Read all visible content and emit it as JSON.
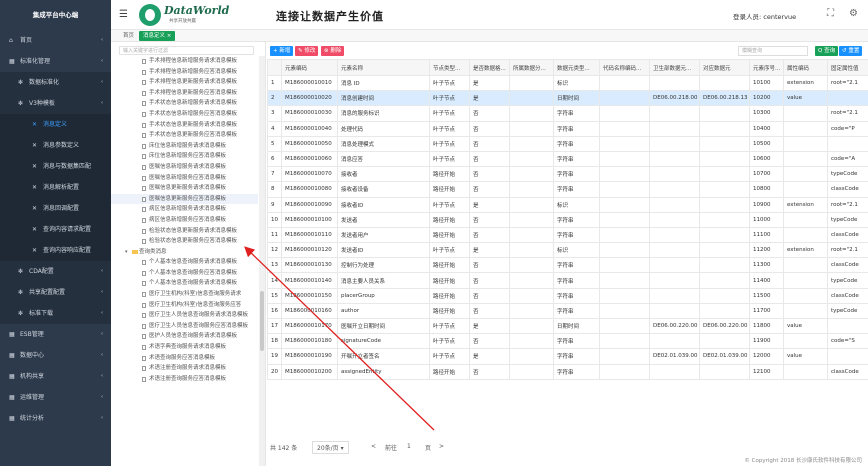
{
  "sidebar": {
    "brand": "集成平台中心端",
    "items": [
      {
        "label": "首页",
        "icon": "home-icon"
      },
      {
        "label": "标准化管理",
        "icon": "grid-icon"
      },
      {
        "label": "数据标准化",
        "icon": "gear-icon"
      },
      {
        "label": "V3种模板",
        "icon": "gear-icon"
      },
      {
        "label": "消息定义",
        "icon": "tools-icon"
      },
      {
        "label": "消息参数定义",
        "icon": "tools-icon"
      },
      {
        "label": "消息与数据集匹配",
        "icon": "tools-icon"
      },
      {
        "label": "消息解析配置",
        "icon": "tools-icon"
      },
      {
        "label": "消息回调配置",
        "icon": "tools-icon"
      },
      {
        "label": "查询内容请求配置",
        "icon": "tools-icon"
      },
      {
        "label": "查询内容响应配置",
        "icon": "tools-icon"
      },
      {
        "label": "CDA配置",
        "icon": "gear-icon"
      },
      {
        "label": "共享配置配置",
        "icon": "gear-icon"
      },
      {
        "label": "标准下载",
        "icon": "gear-icon"
      },
      {
        "label": "ESB管理",
        "icon": "grid-icon"
      },
      {
        "label": "数据中心",
        "icon": "grid-icon"
      },
      {
        "label": "机构共享",
        "icon": "grid-icon"
      },
      {
        "label": "运维管理",
        "icon": "grid-icon"
      },
      {
        "label": "统计分析",
        "icon": "grid-icon"
      }
    ]
  },
  "topbar": {
    "logo_text": "DataWorld",
    "logo_sub": "共享开放共赢",
    "slogan": "连接让数据产生价值",
    "user_label": "登录人员: centervue"
  },
  "tabs": {
    "home": "首页",
    "active": "消息定义 ×"
  },
  "tree": {
    "search_placeholder": "输入关键字进行过滤",
    "nodes": [
      "手术排程信息新增服务请求消息模板",
      "手术排程信息新增服务应答消息模板",
      "手术排程信息更新服务请求消息模板",
      "手术排程信息更新服务应答消息模板",
      "手术状态信息新增服务请求消息模板",
      "手术状态信息新增服务应答消息模板",
      "手术状态信息更新服务请求消息模板",
      "手术状态信息更新服务应答消息模板",
      "床位信息新增服务请求消息模板",
      "床位信息新增服务应答消息模板",
      "医嘱信息新增服务请求消息模板",
      "医嘱信息新增服务应答消息模板",
      "医嘱信息更新服务请求消息模板",
      "医嘱信息更新服务应答消息模板",
      "病区信息新增服务请求消息模板",
      "病区信息新增服务应答消息模板",
      "检验状态信息更新服务请求消息模板",
      "检验状态信息更新服务应答消息模板",
      "查询类消息",
      "个人基本信息查询服务请求消息模板",
      "个人基本信息查询服务应答消息模板",
      "个人基本信息查询服务请求消息模板",
      "医疗卫生机构(科室)信息查询服务请求",
      "医疗卫生机构(科室)信息查询服务应答",
      "医疗卫生人员信息查询服务请求消息模板",
      "医疗卫生人员信息查询服务应答消息模板",
      "医护人员信息查询服务请求消息模板",
      "术语字典查询服务请求消息模板",
      "术语查询服务应答消息模板",
      "术语注册查询服务请求消息模板",
      "术语注册查询服务应答消息模板"
    ],
    "selected_index": 13,
    "folder_index": 18
  },
  "toolbar": {
    "add": "+ 新增",
    "edit": "✎ 修改",
    "delete": "⊗ 删除",
    "search_placeholder": "模糊查询",
    "query": "Q 查询",
    "reset": "↺ 重置"
  },
  "table": {
    "columns": [
      "",
      "元素编码",
      "元素名称",
      "节点类型...",
      "是否数据格...",
      "所属数据分...",
      "数据元类型...",
      "代码名称编码...",
      "卫生部数据元...",
      "对应数据元",
      "元素序号...",
      "属性编码",
      "固定属性值"
    ],
    "rows": [
      [
        "1",
        "M186000010010",
        "消息 ID",
        "叶子节点",
        "是",
        "",
        "标识",
        "",
        "",
        "",
        "10100",
        "extension",
        "root=\"2.1"
      ],
      [
        "2",
        "M186000010020",
        "消息创建时间",
        "叶子节点",
        "是",
        "",
        "日期时间",
        "",
        "DE06.00.218.00",
        "DE06.00.218.13",
        "10200",
        "value",
        ""
      ],
      [
        "3",
        "M186000010030",
        "消息的服务标识",
        "叶子节点",
        "否",
        "",
        "字符串",
        "",
        "",
        "",
        "10300",
        "",
        "root=\"2.1"
      ],
      [
        "4",
        "M186000010040",
        "处理代码",
        "叶子节点",
        "否",
        "",
        "字符串",
        "",
        "",
        "",
        "10400",
        "",
        "code=\"P"
      ],
      [
        "5",
        "M186000010050",
        "消息处理模式",
        "叶子节点",
        "否",
        "",
        "字符串",
        "",
        "",
        "",
        "10500",
        "",
        ""
      ],
      [
        "6",
        "M186000010060",
        "消息应答",
        "叶子节点",
        "否",
        "",
        "字符串",
        "",
        "",
        "",
        "10600",
        "",
        "code=\"A"
      ],
      [
        "7",
        "M186000010070",
        "接收者",
        "路径开始",
        "否",
        "",
        "字符串",
        "",
        "",
        "",
        "10700",
        "",
        "typeCode"
      ],
      [
        "8",
        "M186000010080",
        "接收者设备",
        "路径开始",
        "否",
        "",
        "字符串",
        "",
        "",
        "",
        "10800",
        "",
        "classCode"
      ],
      [
        "9",
        "M186000010090",
        "接收者ID",
        "叶子节点",
        "是",
        "",
        "标识",
        "",
        "",
        "",
        "10900",
        "extension",
        "root=\"2.1"
      ],
      [
        "10",
        "M186000010100",
        "发送者",
        "路径开始",
        "否",
        "",
        "字符串",
        "",
        "",
        "",
        "11000",
        "",
        "typeCode"
      ],
      [
        "11",
        "M186000010110",
        "发送者用户",
        "路径开始",
        "否",
        "",
        "字符串",
        "",
        "",
        "",
        "11100",
        "",
        "classCode"
      ],
      [
        "12",
        "M186000010120",
        "发送者ID",
        "叶子节点",
        "是",
        "",
        "标识",
        "",
        "",
        "",
        "11200",
        "extension",
        "root=\"2.1"
      ],
      [
        "13",
        "M186000010130",
        "控制行为处理",
        "路径开始",
        "否",
        "",
        "字符串",
        "",
        "",
        "",
        "11300",
        "",
        "classCode"
      ],
      [
        "14",
        "M186000010140",
        "消息主要人员关系",
        "路径开始",
        "否",
        "",
        "字符串",
        "",
        "",
        "",
        "11400",
        "",
        "typeCode"
      ],
      [
        "15",
        "M186000010150",
        "placerGroup",
        "路径开始",
        "否",
        "",
        "字符串",
        "",
        "",
        "",
        "11500",
        "",
        "classCode"
      ],
      [
        "16",
        "M186000010160",
        "author",
        "路径开始",
        "否",
        "",
        "字符串",
        "",
        "",
        "",
        "11700",
        "",
        "typeCode"
      ],
      [
        "17",
        "M186000010170",
        "医嘱开立日期时间",
        "叶子节点",
        "是",
        "",
        "日期时间",
        "",
        "DE06.00.220.00",
        "DE06.00.220.00",
        "11800",
        "value",
        ""
      ],
      [
        "18",
        "M186000010180",
        "signatureCode",
        "叶子节点",
        "否",
        "",
        "字符串",
        "",
        "",
        "",
        "11900",
        "",
        "code=\"S"
      ],
      [
        "19",
        "M186000010190",
        "开嘱开立者签名",
        "叶子节点",
        "是",
        "",
        "字符串",
        "",
        "DE02.01.039.00",
        "DE02.01.039.00",
        "12000",
        "value",
        ""
      ],
      [
        "20",
        "M186000010200",
        "assignedEntity",
        "路径开始",
        "否",
        "",
        "字符串",
        "",
        "",
        "",
        "12100",
        "",
        "classCode"
      ]
    ],
    "selected_row": 1
  },
  "footer": {
    "total": "共 142 条",
    "per_page": "20条/页 ▾",
    "prev": "<",
    "goto_label": "前往",
    "page": "1",
    "page_suffix": "页",
    "next": ">"
  },
  "copyright": "© Copyright 2018 长沙康氏软件科技有限公司",
  "annotation": {
    "color": "#e02020"
  }
}
